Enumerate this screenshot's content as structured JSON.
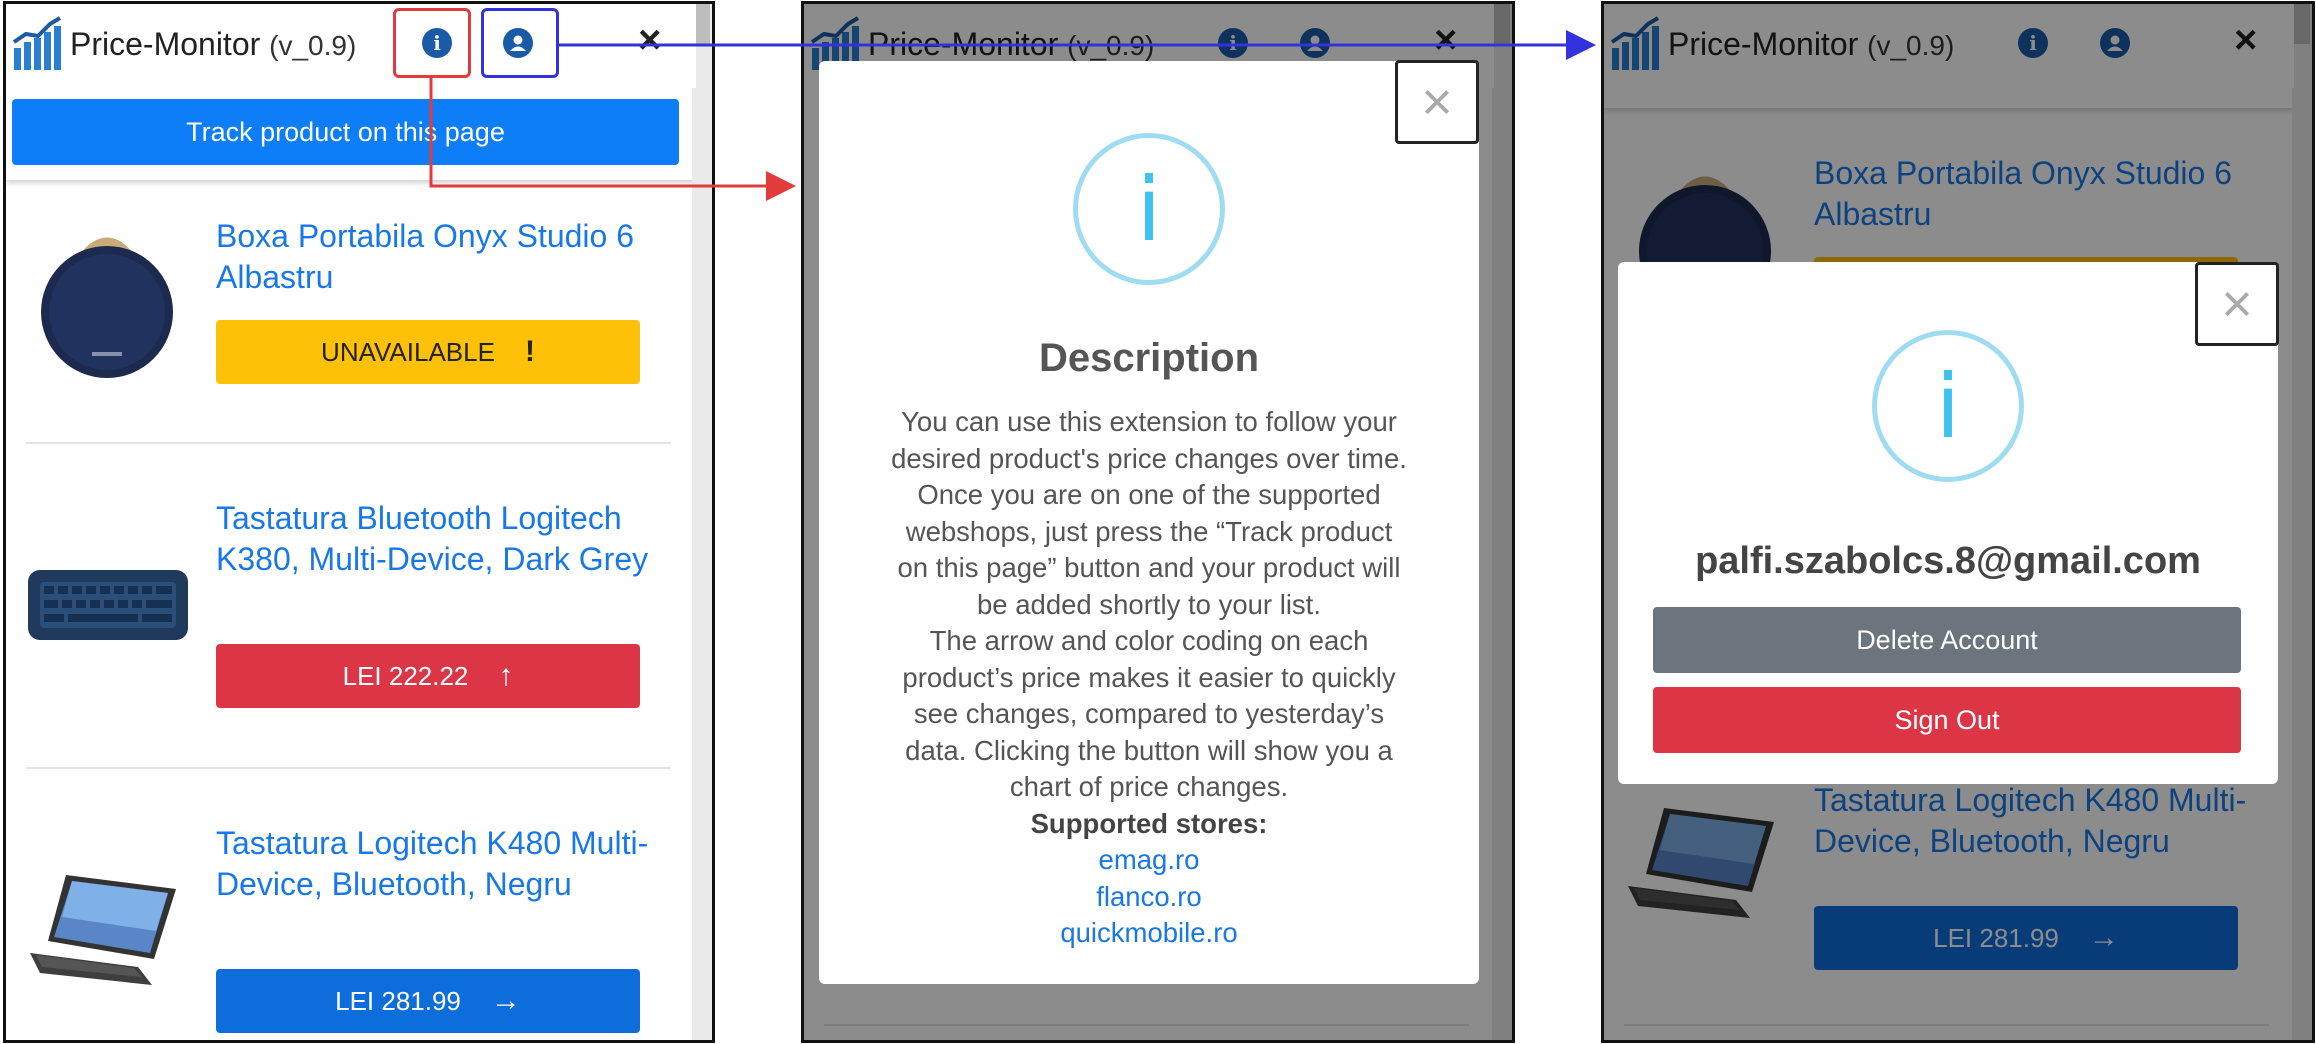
{
  "app": {
    "title": "Price-Monitor",
    "version": "(v_0.9)",
    "close_glyph": "×"
  },
  "track_button": "Track product on this page",
  "products": [
    {
      "name": "Boxa Portabila Onyx Studio 6 Albastru",
      "button_label": "UNAVAILABLE",
      "button_icon": "!",
      "status": "unavailable",
      "color": "#ffc107"
    },
    {
      "name": "Tastatura Bluetooth Logitech K380, Multi-Device, Dark Grey",
      "button_label": "LEI 222.22",
      "button_icon": "↑",
      "status": "price-up",
      "color": "#dc3545"
    },
    {
      "name": "Tastatura Logitech K480 Multi-Device, Bluetooth, Negru",
      "button_label": "LEI 281.99",
      "button_icon": "→",
      "status": "price-same",
      "color": "#0d6ddb"
    }
  ],
  "description_modal": {
    "close_glyph": "×",
    "icon_glyph": "i",
    "title": "Description",
    "body_lines": [
      "You can use this extension to follow your",
      "desired product's price changes over time.",
      "Once you are on one of the supported",
      "webshops, just press the “Track product",
      "on this page” button and your product will",
      "be added shortly to your list.",
      "The arrow and color coding on each",
      "product’s price makes it easier to quickly",
      "see changes, compared to yesterday’s",
      "data. Clicking the button will show you a",
      "chart of price changes."
    ],
    "stores_heading": "Supported stores:",
    "stores": [
      "emag.ro",
      "flanco.ro",
      "quickmobile.ro"
    ]
  },
  "account_modal": {
    "close_glyph": "×",
    "icon_glyph": "i",
    "email": "palfi.szabolcs.8@gmail.com",
    "delete_label": "Delete Account",
    "signout_label": "Sign Out"
  },
  "colors": {
    "accent": "#0d7ef7",
    "info_highlight": "#e23b3b",
    "account_highlight": "#3333dd"
  }
}
